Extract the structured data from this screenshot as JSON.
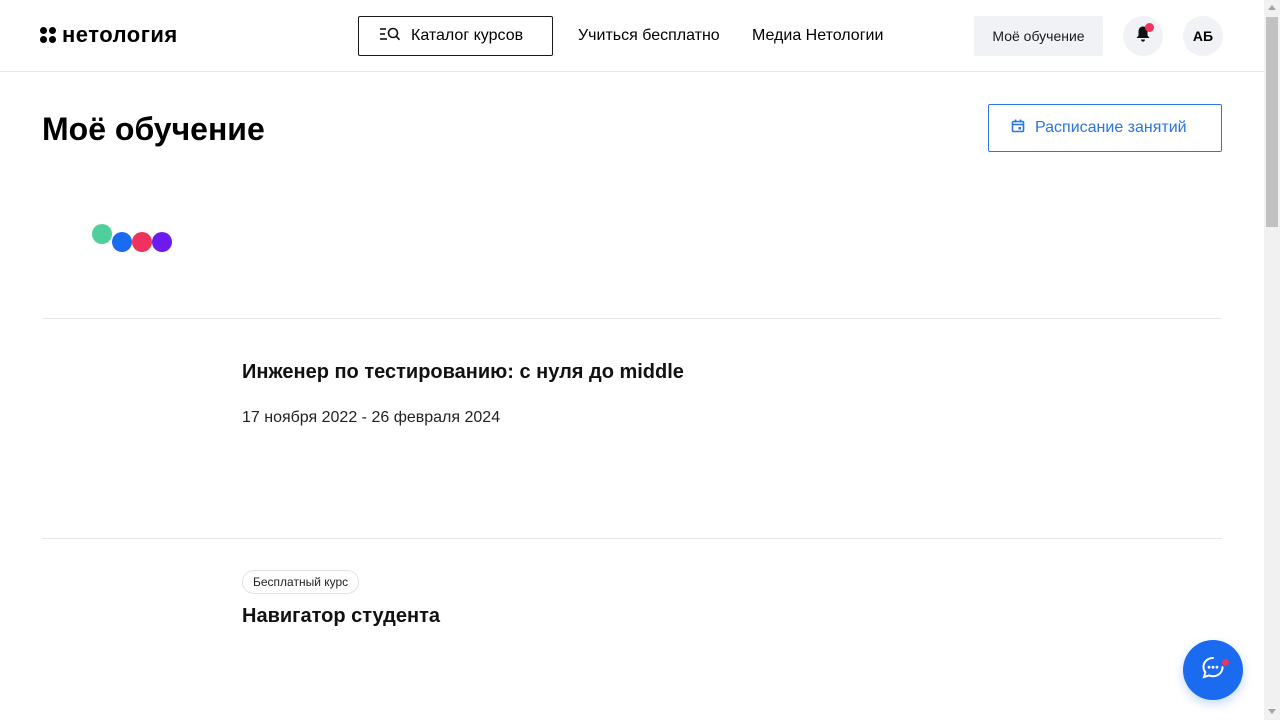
{
  "header": {
    "logo_text": "нетология",
    "catalog_label": "Каталог курсов",
    "nav": {
      "free_label": "Учиться бесплатно",
      "media_label": "Медиа Нетологии"
    },
    "my_learning_label": "Моё обучение",
    "avatar_initials": "АБ",
    "has_notification": true
  },
  "main": {
    "title": "Моё обучение",
    "schedule_label": "Расписание занятий"
  },
  "courses": [
    {
      "title": "Инженер по тестированию: с нуля до middle",
      "dates": "17 ноября 2022 - 26 февраля 2024"
    },
    {
      "badge": "Бесплатный курс",
      "title": "Навигатор студента"
    }
  ],
  "colors": {
    "accent_blue": "#1a6bf0",
    "accent_pink": "#f0325e",
    "accent_green": "#4fcf9b",
    "accent_purple": "#6b1af0",
    "link_blue": "#2a74e6"
  },
  "icons": {
    "catalog": "catalog-search-icon",
    "bell": "bell-icon",
    "calendar": "calendar-icon",
    "chat": "chat-icon"
  }
}
